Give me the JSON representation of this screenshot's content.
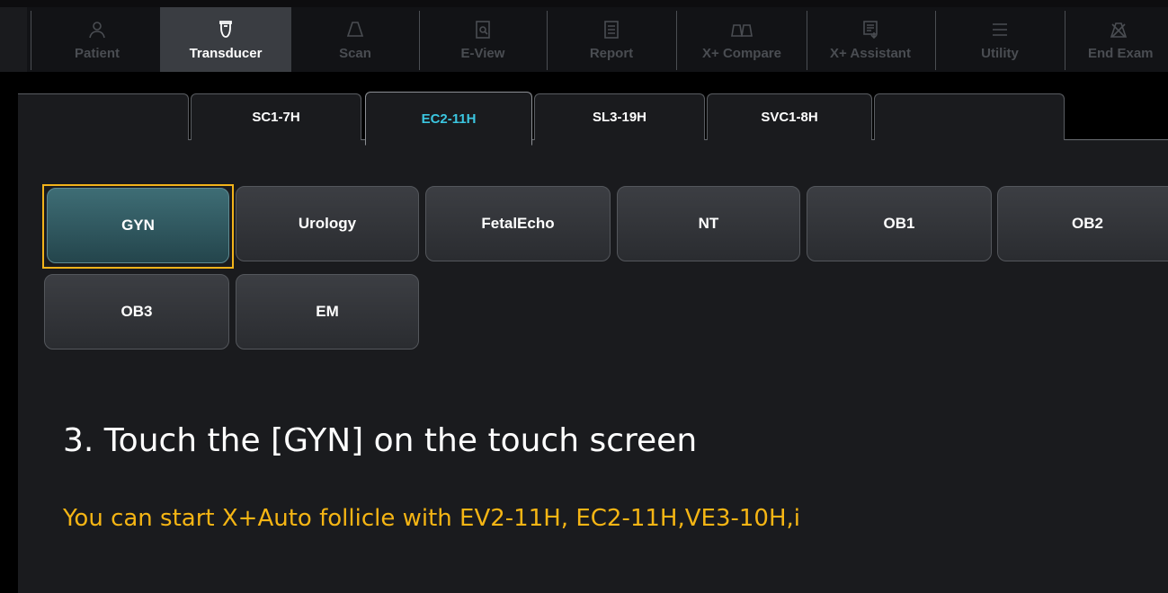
{
  "toolbar": {
    "items": [
      {
        "label": "Patient",
        "icon": "person-icon"
      },
      {
        "label": "Transducer",
        "icon": "transducer-icon",
        "active": true
      },
      {
        "label": "Scan",
        "icon": "scan-icon"
      },
      {
        "label": "E-View",
        "icon": "document-search-icon"
      },
      {
        "label": "Report",
        "icon": "report-icon"
      },
      {
        "label": "X+ Compare",
        "icon": "compare-icon"
      },
      {
        "label": "X+ Assistant",
        "icon": "assistant-icon"
      },
      {
        "label": "Utility",
        "icon": "menu-icon"
      },
      {
        "label": "End Exam",
        "icon": "end-exam-icon"
      }
    ]
  },
  "tabs": [
    {
      "label": ""
    },
    {
      "label": "SC1-7H"
    },
    {
      "label": "EC2-11H",
      "active": true
    },
    {
      "label": "SL3-19H"
    },
    {
      "label": "SVC1-8H"
    },
    {
      "label": ""
    }
  ],
  "presets": {
    "row1": [
      "GYN",
      "Urology",
      "FetalEcho",
      "NT",
      "OB1",
      "OB2"
    ],
    "row2": [
      "OB3",
      "EM"
    ],
    "selected": "GYN"
  },
  "instruction": "3. Touch the [GYN] on the touch screen",
  "note": "You can start X+Auto follicle with EV2-11H, EC2-11H,VE3-10H,i",
  "colors": {
    "accent_tab": "#3bc6e0",
    "highlight": "#f2b31a",
    "selected_preset": "#356069"
  }
}
